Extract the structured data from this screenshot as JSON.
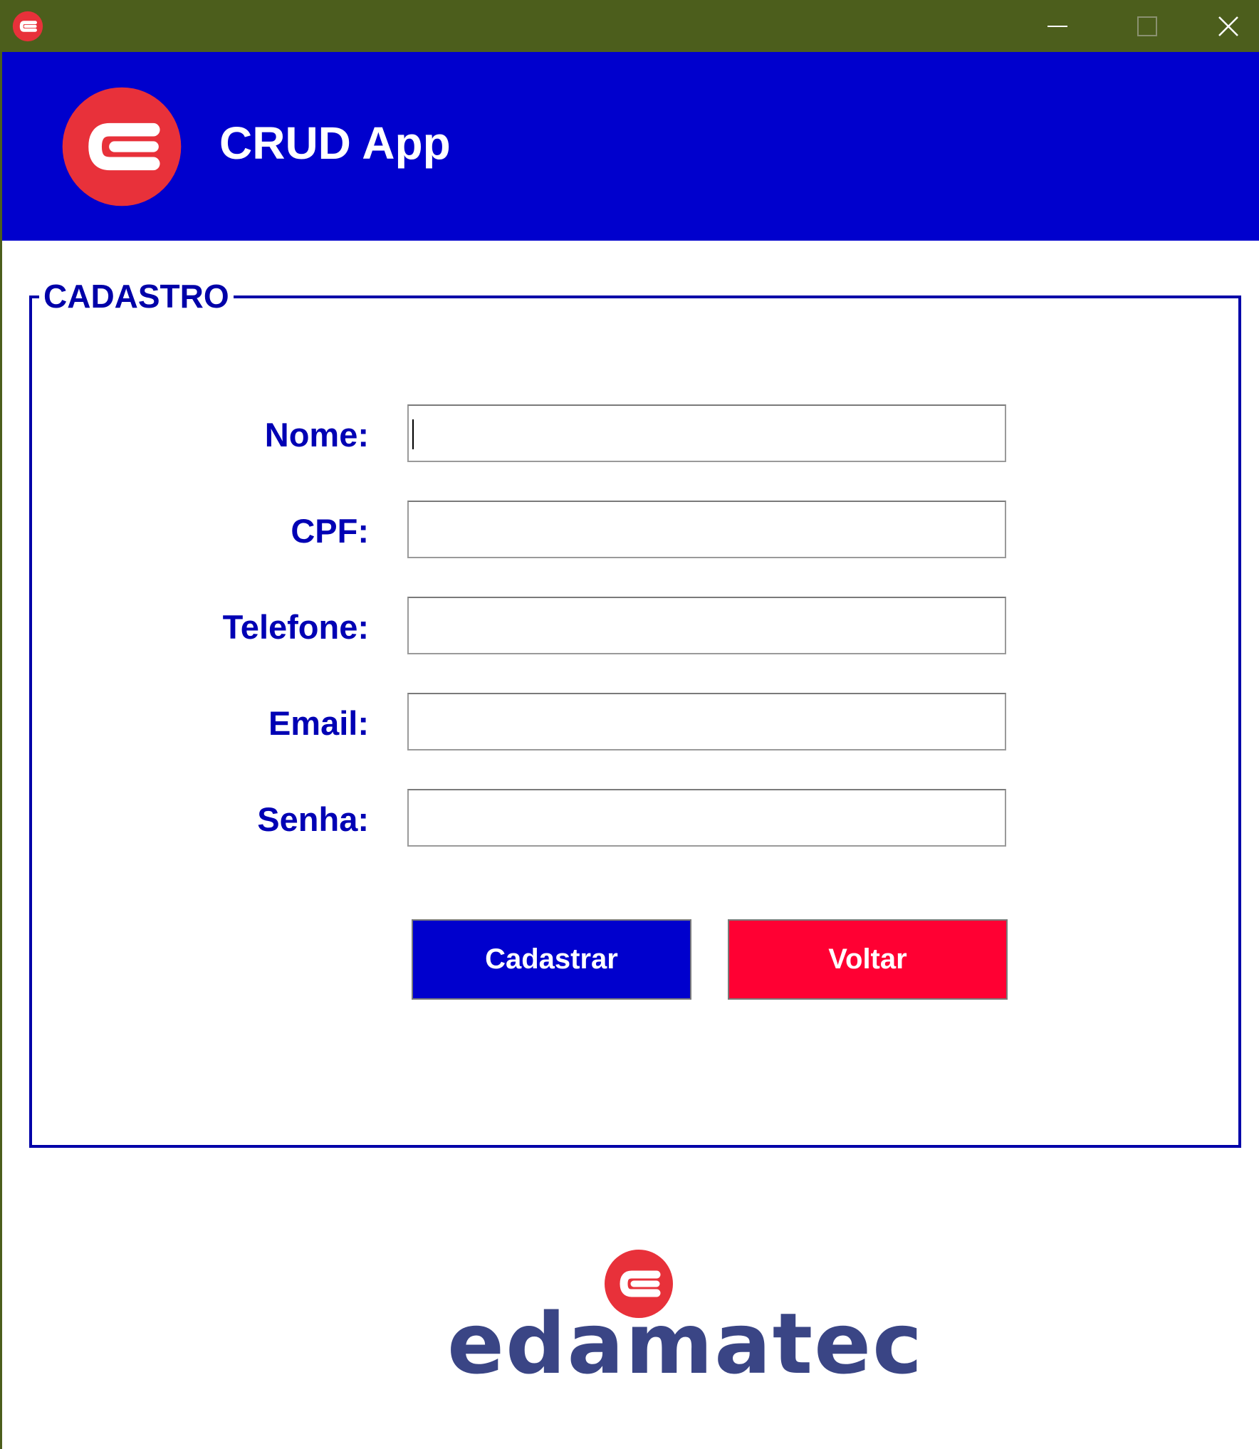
{
  "window": {
    "controls": {
      "minimize": "minimize-icon",
      "maximize": "maximize-icon",
      "close": "close-icon"
    }
  },
  "header": {
    "title": "CRUD App",
    "logo_icon": "edamatec-logo-icon"
  },
  "form": {
    "group_title": "CADASTRO",
    "fields": [
      {
        "label": "Nome:",
        "value": ""
      },
      {
        "label": "CPF:",
        "value": ""
      },
      {
        "label": "Telefone:",
        "value": ""
      },
      {
        "label": "Email:",
        "value": ""
      },
      {
        "label": "Senha:",
        "value": ""
      }
    ],
    "buttons": {
      "submit_label": "Cadastrar",
      "back_label": "Voltar"
    }
  },
  "footer": {
    "brand": "edamatec"
  },
  "colors": {
    "titlebar": "#4c5e1c",
    "header": "#0000cd",
    "primary_button": "#0000cd",
    "back_button": "#ff0033",
    "logo_red": "#e8313a",
    "brand_text": "#3a4585",
    "label_text": "#0000b4"
  }
}
